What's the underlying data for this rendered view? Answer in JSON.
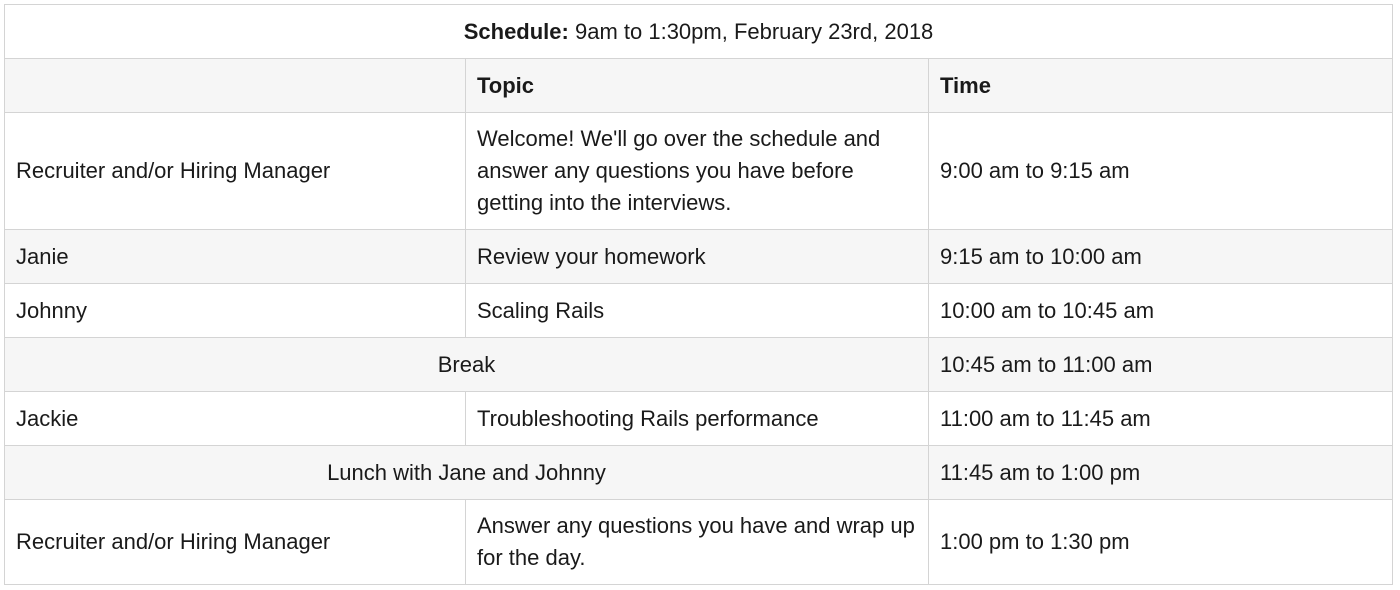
{
  "schedule": {
    "title_label": "Schedule:",
    "title_text": " 9am to 1:30pm, February 23rd, 2018",
    "headers": {
      "first": "",
      "topic": "Topic",
      "time": "Time"
    },
    "rows": [
      {
        "person": "Recruiter and/or Hiring Manager",
        "topic": "Welcome! We'll go over the schedule and answer any questions you have before getting into the interviews.",
        "time": "9:00 am to 9:15 am"
      },
      {
        "person": "Janie",
        "topic": "Review your homework",
        "time": "9:15 am to 10:00 am"
      },
      {
        "person": "Johnny",
        "topic": "Scaling Rails",
        "time": "10:00 am to 10:45 am"
      },
      {
        "merged": "Break",
        "time": "10:45 am to 11:00 am"
      },
      {
        "person": "Jackie",
        "topic": "Troubleshooting Rails performance",
        "time": "11:00 am to 11:45 am"
      },
      {
        "merged": "Lunch with Jane and Johnny",
        "time": "11:45 am to 1:00 pm"
      },
      {
        "person": "Recruiter and/or Hiring Manager",
        "topic": "Answer any questions you have and wrap up for the day.",
        "time": "1:00 pm to 1:30 pm"
      }
    ]
  }
}
